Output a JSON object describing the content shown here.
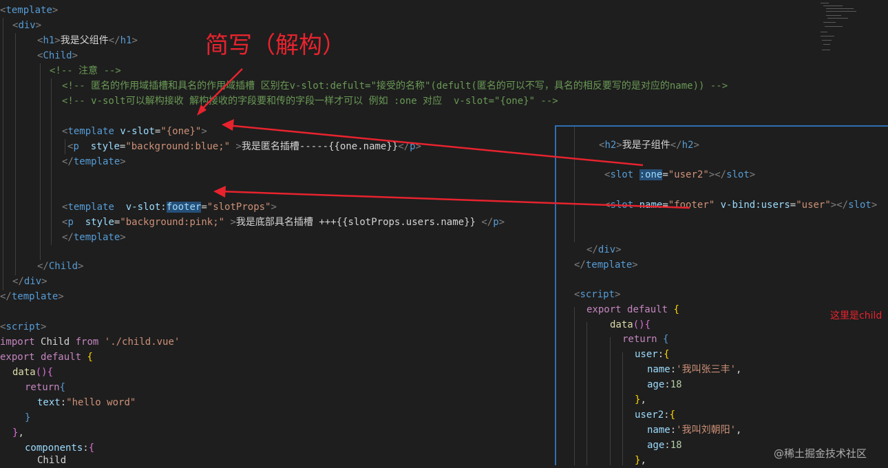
{
  "main_code": {
    "l1_tpl": "template",
    "l2_div": "div",
    "l3_h1": "h1",
    "l3_text": "我是父组件",
    "l4_child": "Child",
    "l5_comment": "<!-- 注意 -->",
    "l6_comment": "<!-- 匿名的作用域插槽和具名的作用域插槽 区别在v-slot:defult=\"接受的名称\"(defult(匿名的可以不写，具名的相反要写的是对应的name)) -->",
    "l7_comment": "<!-- v-solt可以解构接收 解构接收的字段要和传的字段一样才可以 例如 :one 对应  v-slot=\"{one}\" -->",
    "l9_tpl": "template",
    "l9_attr": "v-slot",
    "l9_val": "\"{one}\"",
    "l10_p": "p",
    "l10_attr": "style",
    "l10_val": "\"background:blue;\"",
    "l10_text": "我是匿名插槽-----{{one.name}}",
    "l11_tpl": "template",
    "l14_tpl": "template",
    "l14_attr1": "v-slot:",
    "l14_attr2": "footer",
    "l14_val": "\"slotProps\"",
    "l15_p": "p",
    "l15_attr": "style",
    "l15_val": "\"background:pink;\"",
    "l15_text": "我是底部具名插槽 +++{{slotProps.users.name}}",
    "l16_tpl": "template",
    "l18_child": "Child",
    "l19_div": "div",
    "l20_tpl": "template",
    "l22_script": "script",
    "l23_import": "import",
    "l23_name": "Child",
    "l23_from": "from",
    "l23_path": "'./child.vue'",
    "l24_export": "export",
    "l24_default": "default",
    "l25_data": "data",
    "l26_return": "return",
    "l27_key": "text",
    "l27_val": "\"hello word\"",
    "l30_key": "components",
    "l31_name": "Child"
  },
  "child_code": {
    "c1_h2": "h2",
    "c1_text": "我是子组件",
    "c2_slot": "slot",
    "c2_attr": ":one",
    "c2_val": "\"user2\"",
    "c3_slot": "slot",
    "c3_attr1": "name",
    "c3_val1": "\"footer\"",
    "c3_attr2": "v-bind:users",
    "c3_val2": "\"user\"",
    "c5_div": "div",
    "c6_tpl": "template",
    "c8_script": "script",
    "c9_export": "export",
    "c9_default": "default",
    "c10_data": "data",
    "c11_return": "return",
    "c12_key": "user",
    "c13_key": "name",
    "c13_val": "'我叫张三丰'",
    "c14_key": "age",
    "c14_val": "18",
    "c16_key": "user2",
    "c17_key": "name",
    "c17_val": "'我叫刘朝阳'",
    "c18_key": "age",
    "c18_val": "18"
  },
  "annotations": {
    "title": "简写（解构）",
    "side_note": "这里是child",
    "watermark": "@稀土掘金技术社区"
  },
  "colors": {
    "background": "#1e1e1e",
    "tag": "#569cd6",
    "attribute": "#9cdcfe",
    "string": "#ce9178",
    "comment": "#6a9955",
    "keyword": "#c586c0",
    "annotation_red": "#e8232e",
    "pane_border": "#2f6fb4"
  }
}
